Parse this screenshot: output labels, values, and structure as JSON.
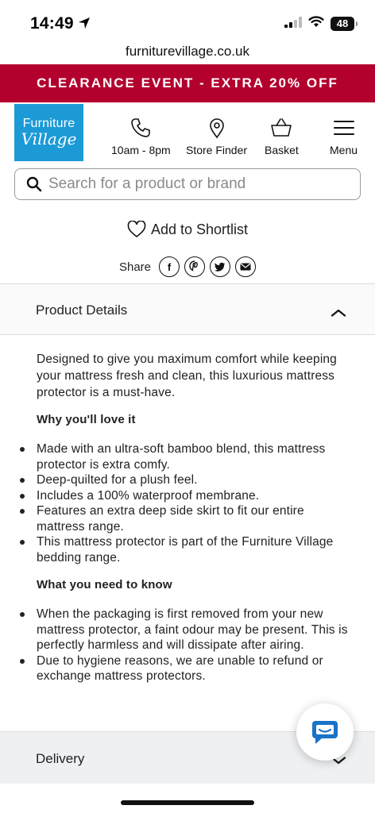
{
  "status": {
    "time": "14:49",
    "battery": "48"
  },
  "browser": {
    "url": "furniturevillage.co.uk"
  },
  "promo": {
    "text": "CLEARANCE EVENT - EXTRA 20% OFF"
  },
  "header": {
    "logo_line1": "Furniture",
    "logo_line2": "Village",
    "nav": [
      {
        "label": "10am - 8pm",
        "icon": "phone-icon"
      },
      {
        "label": "Store Finder",
        "icon": "location-pin-icon"
      },
      {
        "label": "Basket",
        "icon": "basket-icon"
      },
      {
        "label": "Menu",
        "icon": "hamburger-icon"
      }
    ]
  },
  "search": {
    "placeholder": "Search for a product or brand"
  },
  "product": {
    "shortlist_label": "Add to Shortlist",
    "share_label": "Share",
    "share_buttons": [
      "facebook-icon",
      "pinterest-icon",
      "twitter-icon",
      "email-icon"
    ]
  },
  "details": {
    "heading": "Product Details",
    "intro": "Designed to give you maximum comfort while keeping your mattress fresh and clean, this luxurious mattress protector is a must-have.",
    "love_heading": "Why you'll love it",
    "love_items": [
      "Made with an ultra-soft bamboo blend, this mattress protector is extra comfy.",
      "Deep-quilted for a plush feel.",
      "Includes a 100% waterproof membrane.",
      "Features an extra deep side skirt to fit our entire mattress range.",
      "This mattress protector is part of the Furniture Village bedding range."
    ],
    "know_heading": "What you need to know",
    "know_items": [
      "When the packaging is first removed from your new mattress protector, a faint odour may be present. This is perfectly harmless and will dissipate after airing.",
      "Due to hygiene reasons, we are unable to refund or exchange mattress protectors."
    ]
  },
  "delivery": {
    "heading": "Delivery"
  },
  "colors": {
    "promo": "#b3002d",
    "logo": "#1b9ad6",
    "chat": "#1a73c8"
  }
}
